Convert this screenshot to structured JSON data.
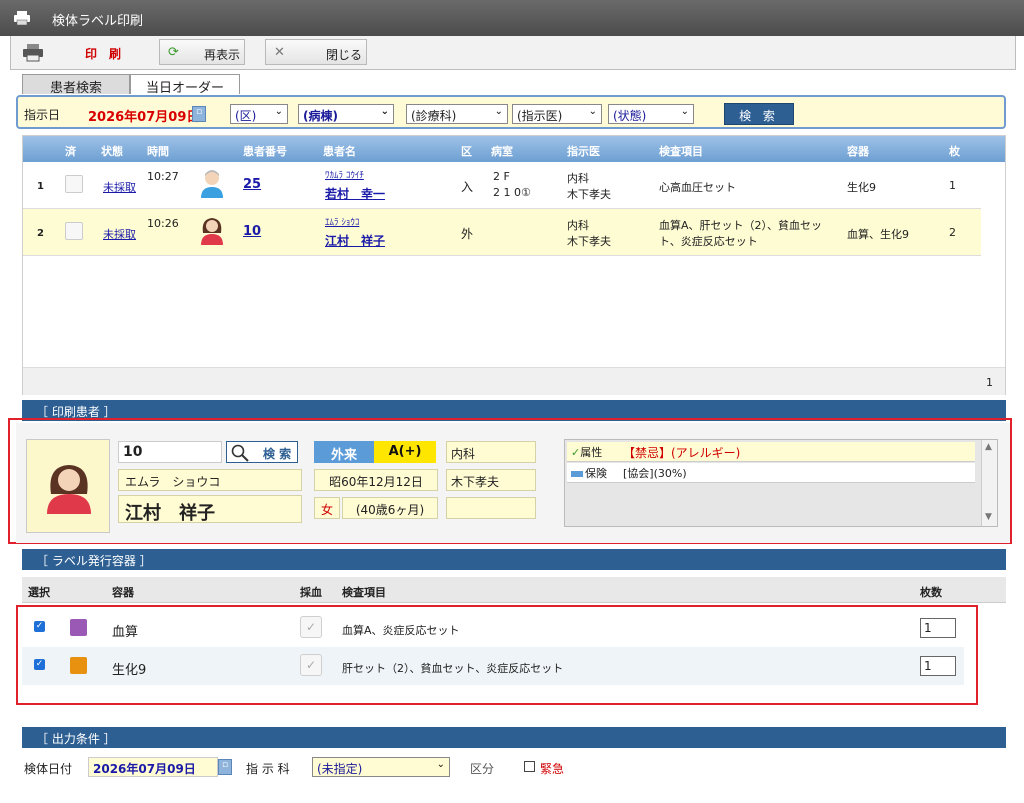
{
  "window": {
    "title": "検体ラベル印刷"
  },
  "toolbar": {
    "print_label": "印　刷",
    "refresh_label": "再表示",
    "close_label": "閉じる"
  },
  "tabs": [
    {
      "label": "患者検索"
    },
    {
      "label": "当日オーダー"
    }
  ],
  "filter": {
    "date_label": "指示日",
    "date_value": "2026年07月09日",
    "ward_sel": "(区)",
    "building_sel": "(病棟)",
    "dept_sel": "(診療科)",
    "doctor_sel": "(指示医)",
    "status_sel": "(状態)",
    "search_label": "検 索"
  },
  "patient_table": {
    "columns": [
      "済",
      "状態",
      "時間",
      "患者番号",
      "患者名",
      "区",
      "病室",
      "指示医",
      "検査項目",
      "容器",
      "枚"
    ],
    "rows": [
      {
        "no": "1",
        "status": "未採取",
        "time": "10:27",
        "patient_id": "25",
        "kana": "ﾜｶﾑﾗ ｺｳｲﾁ",
        "name": "若村　幸一",
        "ward": "入",
        "room1": "2 F",
        "room2": "2 1 0①",
        "dept": "内科",
        "doctor": "木下孝夫",
        "tests": "心高血圧セット",
        "tests2": "",
        "container": "生化9",
        "count": "1"
      },
      {
        "no": "2",
        "status": "未採取",
        "time": "10:26",
        "patient_id": "10",
        "kana": "ｴﾑﾗ ｼｮｳｺ",
        "name": "江村　祥子",
        "ward": "外",
        "room1": "",
        "room2": "",
        "dept": "内科",
        "doctor": "木下孝夫",
        "tests": "血算A、肝セット（2）、貧血セッ",
        "tests2": "ト、炎症反応セット",
        "container": "血算、生化9",
        "count": "2"
      }
    ],
    "footer_count": "1"
  },
  "print_patient": {
    "section_title": "［ 印刷患者 ］",
    "id": "10",
    "search_label": "検 索",
    "kana": "エムラ　ショウコ",
    "name": "江村　祥子",
    "visit_type": "外来",
    "blood_type": "A(+)",
    "dob": "昭60年12月12日",
    "sex": "女",
    "age": "(40歳6ヶ月)",
    "dept": "内科",
    "doctor": "木下孝夫",
    "attr_label": "属性",
    "attr_value": "【禁忌】(アレルギー)",
    "insurance_label": "保険",
    "insurance_value": "[協会](30%)"
  },
  "label_containers": {
    "section_title": "［ ラベル発行容器 ］",
    "columns": [
      "選択",
      "容器",
      "採血",
      "検査項目",
      "枚数"
    ],
    "rows": [
      {
        "container": "血算",
        "color": "#9b59b6",
        "tests": "血算A、炎症反応セット",
        "count": "1"
      },
      {
        "container": "生化9",
        "color": "#e8900f",
        "tests": "肝セット（2）、貧血セット、炎症反応セット",
        "count": "1"
      }
    ]
  },
  "output": {
    "section_title": "［ 出力条件 ］",
    "date_label": "検体日付",
    "date_value": "2026年07月09日",
    "dept_label": "指 示 科",
    "dept_value": "(未指定)",
    "category_label": "区分",
    "urgent_label": "緊急"
  },
  "colors": {
    "accent": "#2d5f93",
    "highlight_row": "#fefcd3",
    "alert_red": "#e0202a"
  }
}
